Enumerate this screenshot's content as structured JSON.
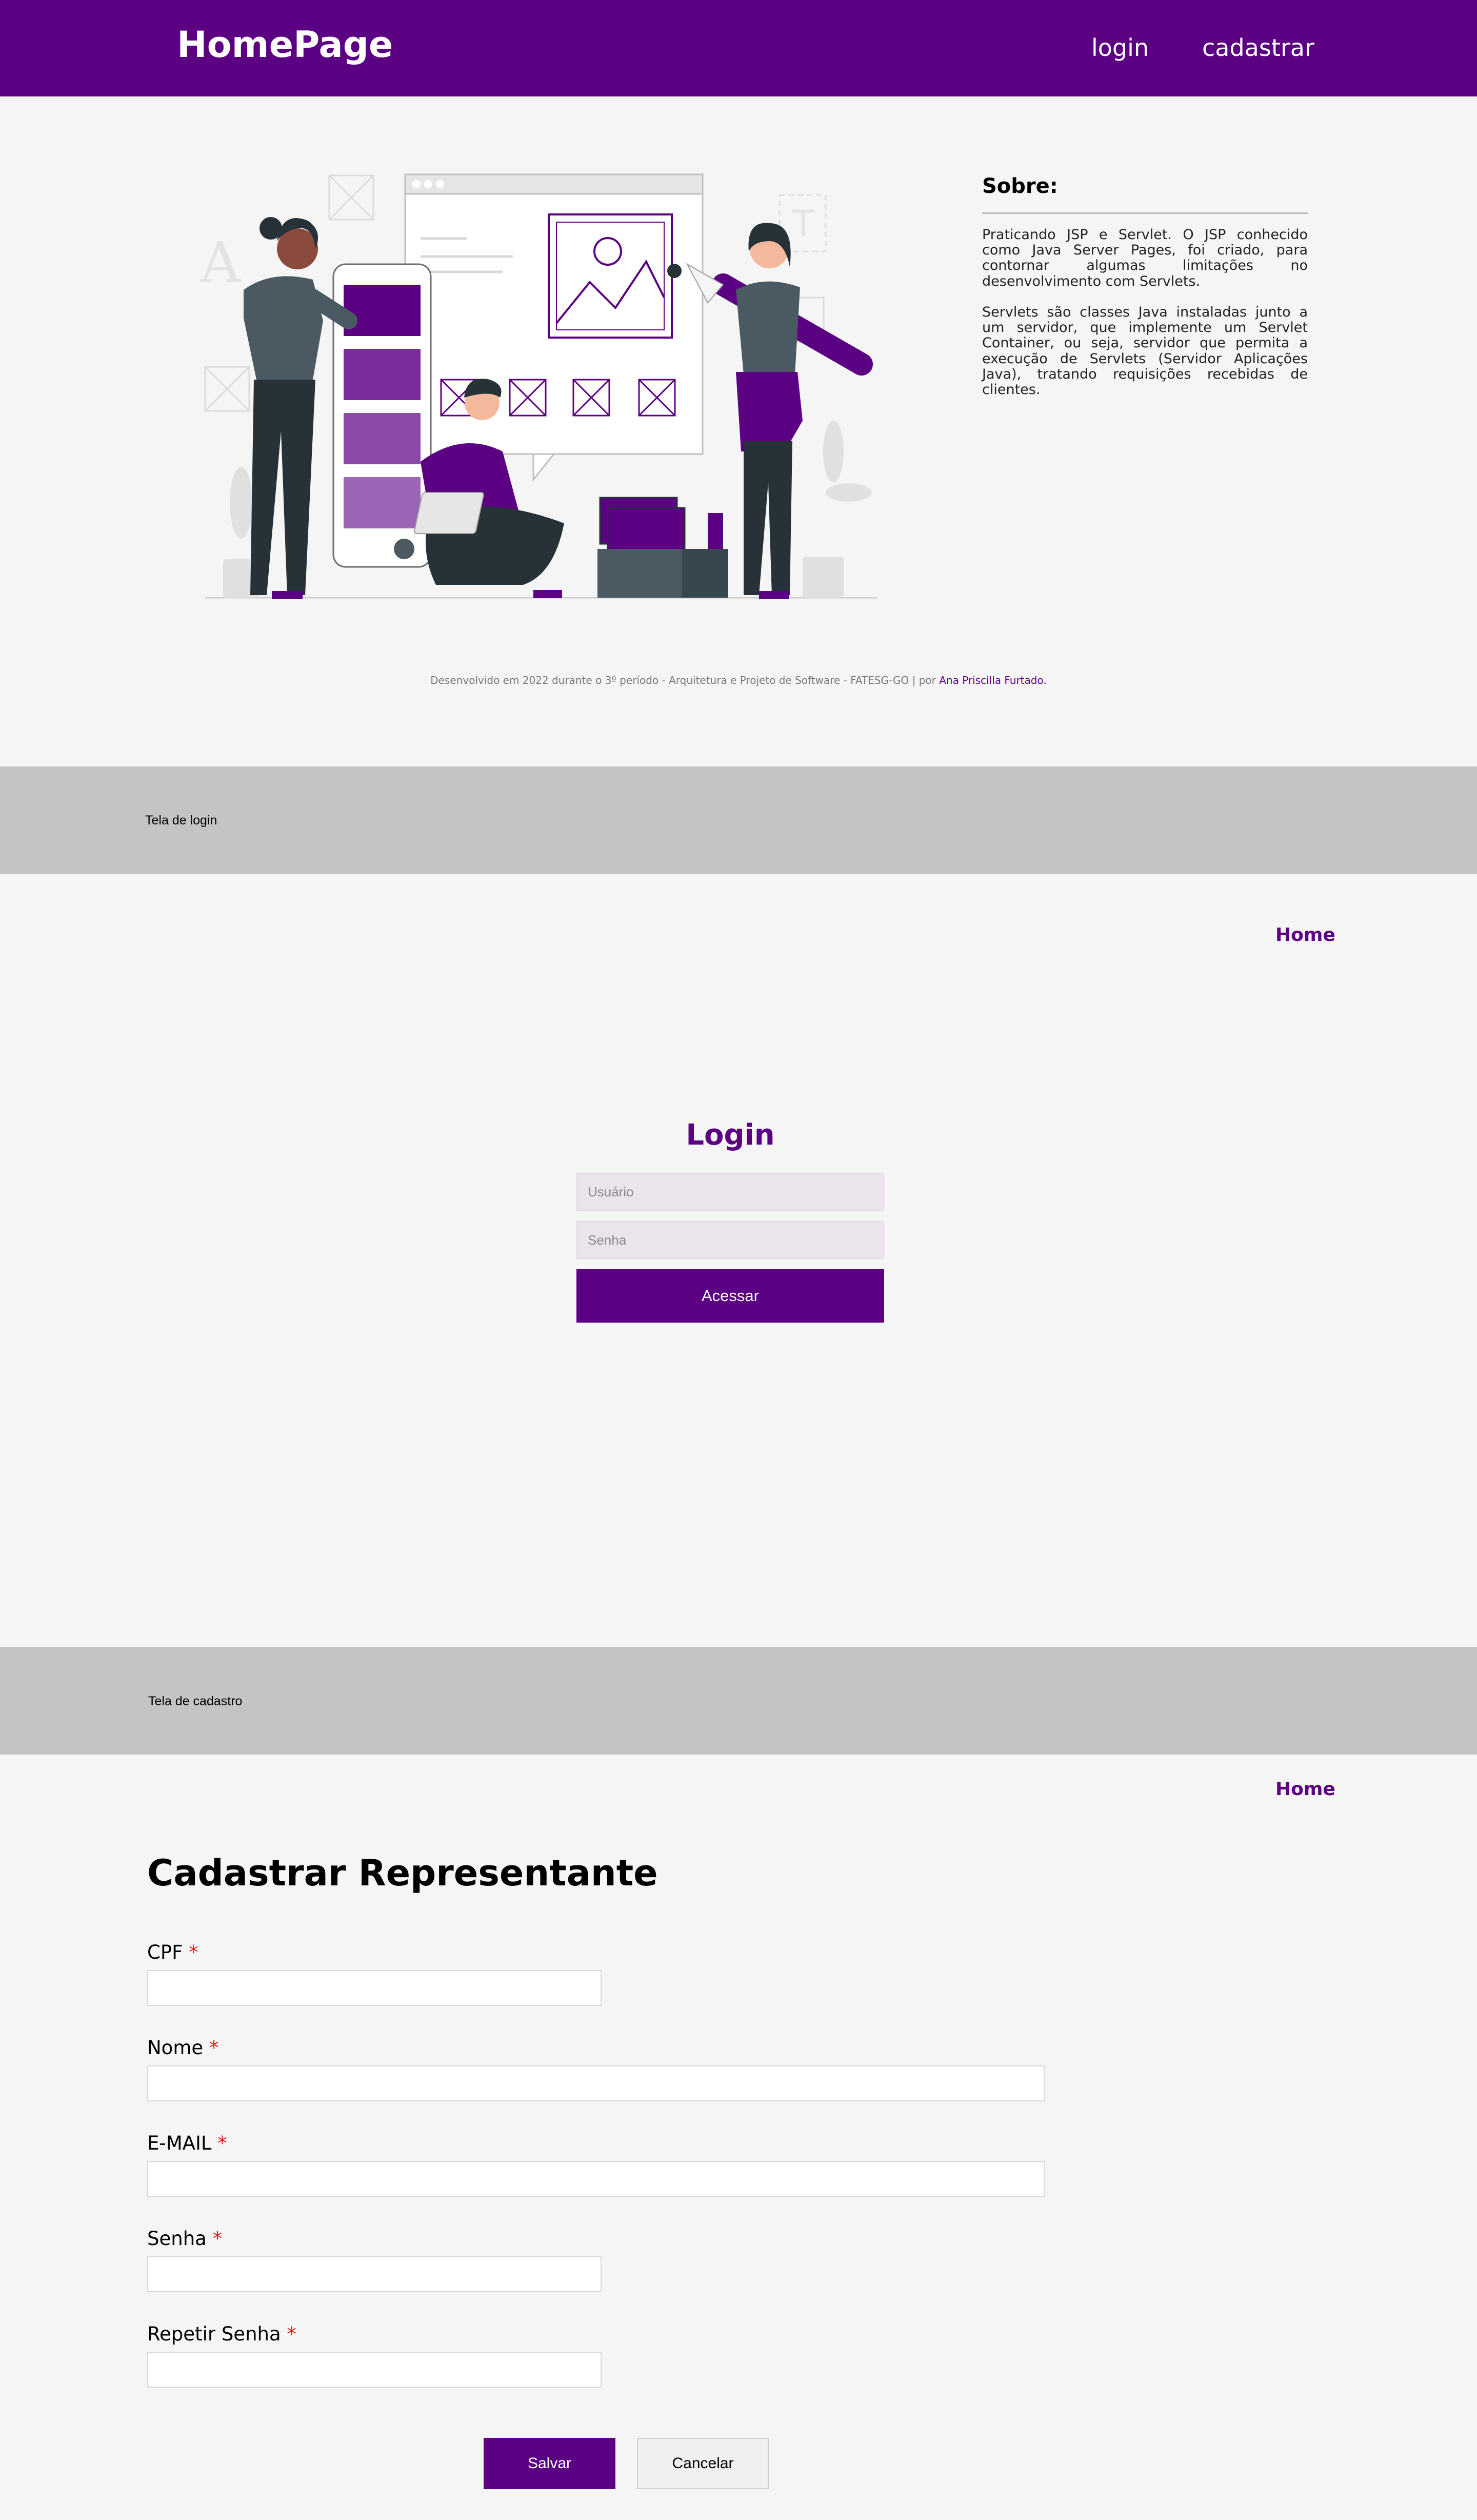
{
  "colors": {
    "brand_purple": "#5c0083",
    "band_gray": "#c4c4c4",
    "background": "#f5f5f5",
    "required_red": "#e02020"
  },
  "home": {
    "header": {
      "brand": "HomePage",
      "nav": [
        "login",
        "cadastrar"
      ]
    },
    "about": {
      "title": "Sobre:",
      "paragraphs": [
        "Praticando JSP e Servlet. O JSP conhecido como Java Server Pages, foi criado, para contornar algumas limitações no desenvolvimento com Servlets.",
        "Servlets são classes Java instaladas junto a um servidor, que implemente um Servlet Container, ou seja, servidor que permita a execução de Servlets (Servidor Aplicações Java), tratando requisições recebidas de clientes."
      ]
    },
    "footer": {
      "text": "Desenvolvido em 2022 durante o 3º período - Arquitetura e Projeto de Software - FATESG-GO | por ",
      "author": "Ana Priscilla Furtado."
    }
  },
  "login_screen": {
    "band_label": "Tela de login",
    "home_link": "Home",
    "title": "Login",
    "user_placeholder": "Usuário",
    "password_placeholder": "Senha",
    "submit": "Acessar"
  },
  "cadastro_screen": {
    "band_label": "Tela de cadastro",
    "home_link": "Home",
    "title": "Cadastrar Representante",
    "required_mark": "*",
    "fields": [
      {
        "label": "CPF"
      },
      {
        "label": "Nome"
      },
      {
        "label": "E-MAIL"
      },
      {
        "label": "Senha"
      },
      {
        "label": "Repetir Senha"
      }
    ],
    "save": "Salvar",
    "cancel": "Cancelar"
  }
}
